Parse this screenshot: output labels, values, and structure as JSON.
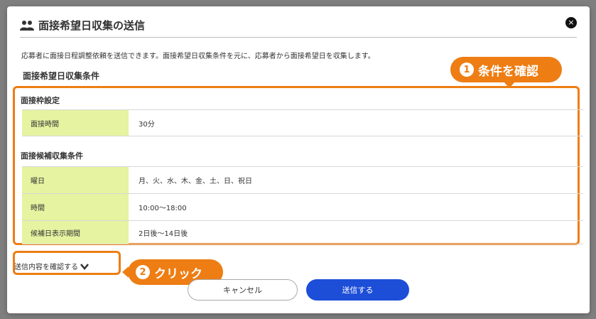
{
  "modal": {
    "title": "面接希望日収集の送信",
    "close_glyph": "×",
    "description": "応募者に面接日程調整依頼を送信できます。面接希望日収集条件を元に、応募者から面接希望日を収集します。",
    "section_title": "面接希望日収集条件"
  },
  "frame_settings": {
    "heading": "面接枠設定",
    "rows": [
      {
        "label": "面接時間",
        "value": "30分"
      }
    ]
  },
  "candidate_conditions": {
    "heading": "面接候補収集条件",
    "rows": [
      {
        "label": "曜日",
        "value": "月、火、水、木、金、土、日、祝日"
      },
      {
        "label": "時間",
        "value": "10:00〜18:00"
      },
      {
        "label": "候補日表示期間",
        "value": "2日後〜14日後"
      }
    ]
  },
  "annotations": {
    "step1": {
      "number": "1",
      "text": "条件を確認"
    },
    "step2": {
      "number": "2",
      "text": "クリック"
    }
  },
  "confirm_link": "送信内容を確認する",
  "buttons": {
    "cancel": "キャンセル",
    "send": "送信する"
  },
  "colors": {
    "accent_orange": "#ee7d13",
    "label_bg": "#e6f3a0",
    "send_button": "#1d4ed8"
  },
  "icons": [
    "users-icon",
    "close-icon",
    "chevron-down-icon"
  ]
}
